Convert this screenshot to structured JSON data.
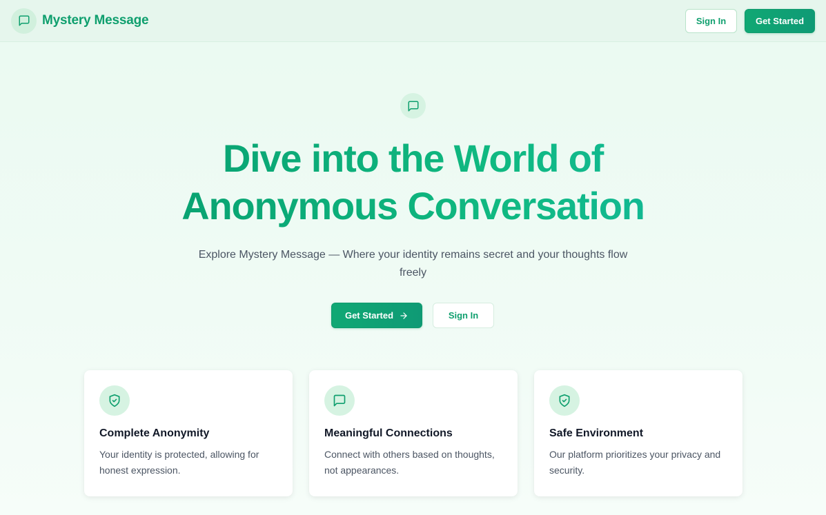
{
  "header": {
    "brand_name": "Mystery Message",
    "brand_icon": "message-square-icon",
    "signin_label": "Sign In",
    "getstarted_label": "Get Started"
  },
  "hero": {
    "icon": "message-square-icon",
    "title_line1": "Dive into the World of",
    "title_line2": "Anonymous Conversation",
    "subtitle": "Explore Mystery Message — Where your identity remains secret and your thoughts flow freely",
    "getstarted_label": "Get Started",
    "getstarted_icon": "arrow-right-icon",
    "signin_label": "Sign In"
  },
  "features": [
    {
      "icon": "shield-check-icon",
      "title": "Complete Anonymity",
      "text": "Your identity is protected, allowing for honest expression."
    },
    {
      "icon": "message-square-icon",
      "title": "Meaningful Connections",
      "text": "Connect with others based on thoughts, not appearances."
    },
    {
      "icon": "shield-check-icon",
      "title": "Safe Environment",
      "text": "Our platform prioritizes your privacy and security."
    }
  ],
  "colors": {
    "brand": "#0f9f6e",
    "accent_bg": "#d6f3e2",
    "page_bg": "#eafaf1"
  }
}
